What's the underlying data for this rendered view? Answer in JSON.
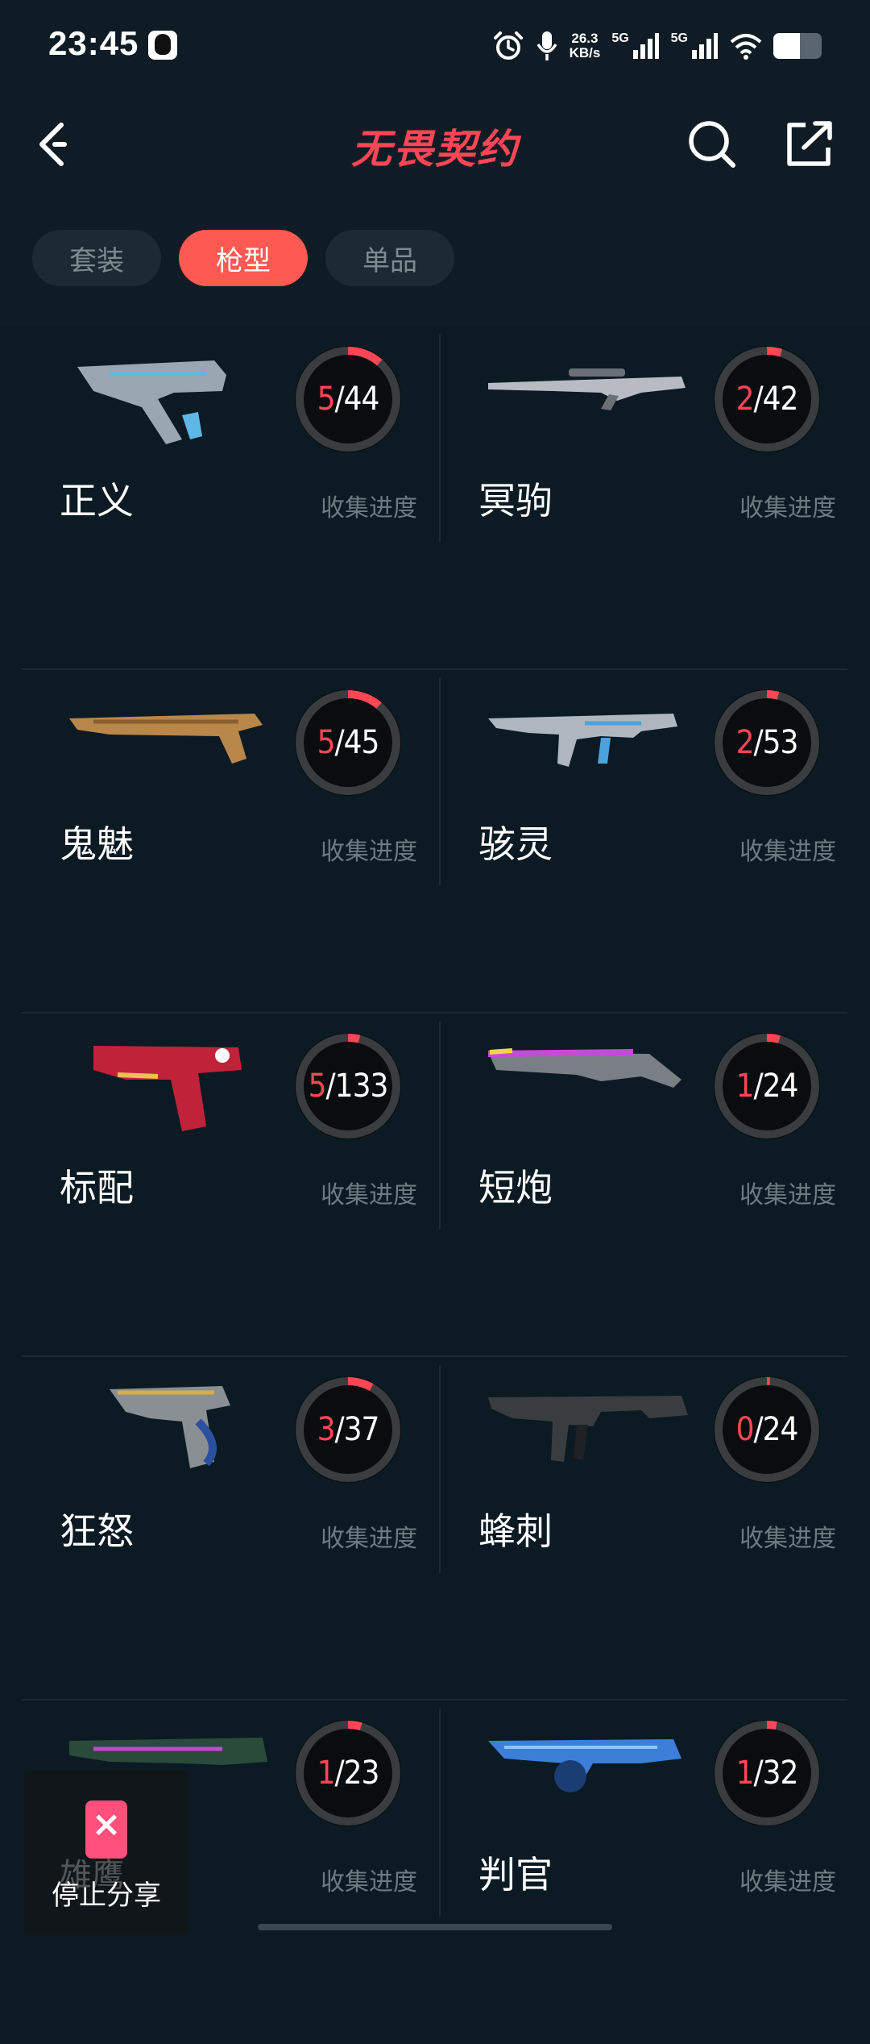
{
  "status_bar": {
    "time": "23:45",
    "net_speed_value": "26.3",
    "net_speed_unit": "KB/s",
    "sim1_label": "5G",
    "sim2_label": "5G",
    "battery_level": 0.55
  },
  "header": {
    "title": "无畏契约",
    "icons": [
      "back-icon",
      "search-icon",
      "share-icon"
    ]
  },
  "tabs": [
    {
      "label": "套装",
      "active": false
    },
    {
      "label": "枪型",
      "active": true
    },
    {
      "label": "单品",
      "active": false
    }
  ],
  "progress_label": "收集进度",
  "weapons": [
    {
      "name": "正义",
      "collected": "5",
      "total": "44",
      "gun": "revolver",
      "color": "#9aa6b2",
      "accent": "#5fb7e8"
    },
    {
      "name": "冥驹",
      "collected": "2",
      "total": "42",
      "gun": "sniper",
      "color": "#b8bcc2",
      "accent": "#6b7077"
    },
    {
      "name": "鬼魅",
      "collected": "5",
      "total": "45",
      "gun": "pistol-long",
      "color": "#b9874a",
      "accent": "#8a5f2e"
    },
    {
      "name": "骇灵",
      "collected": "2",
      "total": "53",
      "gun": "smg",
      "color": "#aeb6bf",
      "accent": "#4aa3df"
    },
    {
      "name": "标配",
      "collected": "5",
      "total": "133",
      "gun": "pistol",
      "color": "#c0223a",
      "accent": "#e8c34a"
    },
    {
      "name": "短炮",
      "collected": "1",
      "total": "24",
      "gun": "shorty",
      "color": "#c24bd8",
      "accent": "#f2d24a"
    },
    {
      "name": "狂怒",
      "collected": "3",
      "total": "37",
      "gun": "frenzy",
      "color": "#8a8f94",
      "accent": "#2c4f9e"
    },
    {
      "name": "蜂刺",
      "collected": "0",
      "total": "24",
      "gun": "stinger",
      "color": "#3a3d40",
      "accent": "#1f2124"
    },
    {
      "name": "",
      "collected": "1",
      "total": "23",
      "gun": "rifle",
      "color": "#2a4a3a",
      "accent": "#c04bd0"
    },
    {
      "name": "判官",
      "collected": "1",
      "total": "32",
      "gun": "judge",
      "color": "#3b7fd8",
      "accent": "#1a3d73"
    }
  ],
  "floating_share": {
    "label": "停止分享",
    "ghost_text": "雄鹰"
  }
}
